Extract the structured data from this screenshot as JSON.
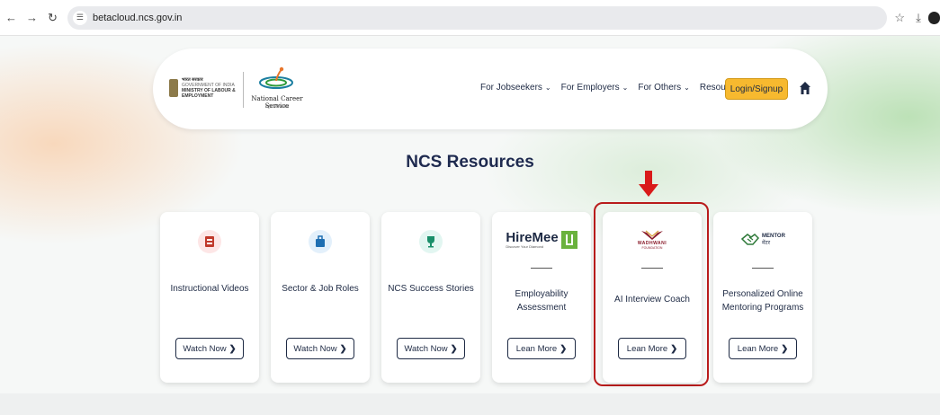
{
  "browser": {
    "url": "betacloud.ncs.gov.in"
  },
  "header": {
    "ministry_line1": "भारत सरकार",
    "ministry_line2": "GOVERNMENT OF INDIA",
    "ministry_line3": "MINISTRY OF LABOUR &",
    "ministry_line4": "EMPLOYMENT",
    "logo_text": "National Career Service",
    "logo_subtext": "राष्ट्रीय करियर सेवा",
    "nav": [
      {
        "label": "For Jobseekers"
      },
      {
        "label": "For Employers"
      },
      {
        "label": "For Others"
      },
      {
        "label": "Resources"
      }
    ],
    "login_label": "Login/Signup"
  },
  "main": {
    "title": "NCS Resources",
    "cards": [
      {
        "title": "Instructional Videos",
        "button": "Watch Now",
        "icon": "video-icon"
      },
      {
        "title": "Sector & Job Roles",
        "button": "Watch Now",
        "icon": "briefcase-icon"
      },
      {
        "title": "NCS Success Stories",
        "button": "Watch Now",
        "icon": "trophy-icon"
      },
      {
        "title": "Employability Assessment",
        "button": "Lean More",
        "logo_text": "HireMee",
        "logo_tag": "Discover Your Diamond"
      },
      {
        "title": "AI Interview Coach",
        "button": "Lean More",
        "logo_text": "WADHWANI",
        "logo_tag": "FOUNDATION"
      },
      {
        "title": "Personalized Online Mentoring Programs",
        "button": "Lean More",
        "logo_text": "MENTOR",
        "logo_tag": "मेंटर"
      }
    ]
  },
  "colors": {
    "accent": "#f7b92f",
    "navy": "#1e2a44",
    "highlight": "#b91c1c"
  }
}
